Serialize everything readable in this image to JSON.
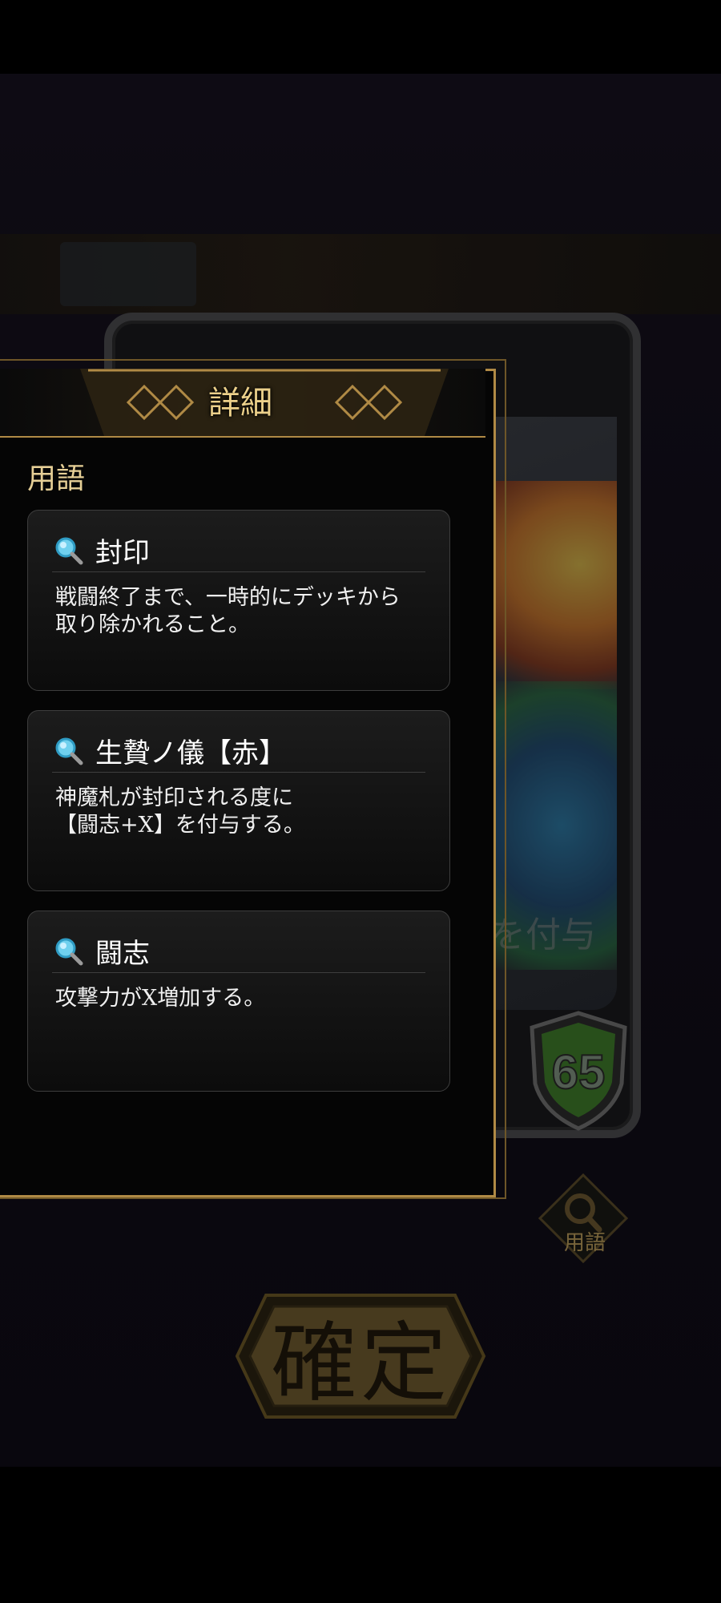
{
  "panel": {
    "title": "詳細",
    "section_label": "用語"
  },
  "terms": [
    {
      "title": "封印",
      "description": "戦闘終了まで、一時的にデッキから\n取り除かれること。"
    },
    {
      "title": "生贄ノ儀【赤】",
      "description": "神魔札が封印される度に\n【闘志+X】を付与する。"
    },
    {
      "title": "闘志",
      "description": "攻撃力がX増加する。"
    }
  ],
  "card": {
    "attack": "65",
    "partial_text": "を付与"
  },
  "glossary_button": {
    "label": "用語"
  },
  "confirm_button": {
    "label": "確定"
  },
  "colors": {
    "gold": "#b08a45",
    "shield_green": "#3e7a2a"
  }
}
